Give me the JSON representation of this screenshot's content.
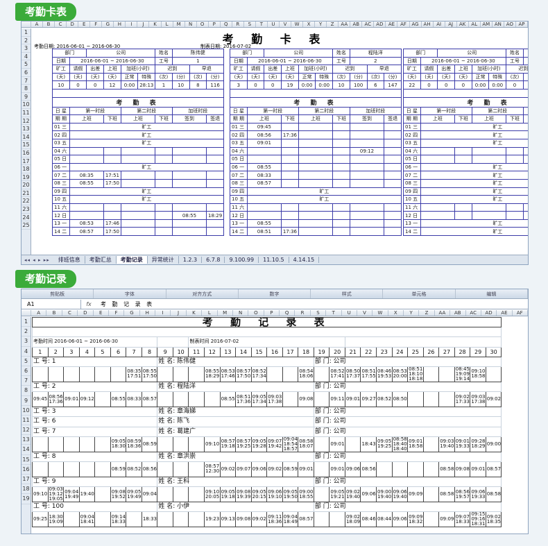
{
  "badges": {
    "card": "考勤卡表",
    "record": "考勤记录"
  },
  "sheet1": {
    "cols": [
      "A",
      "B",
      "C",
      "D",
      "E",
      "F",
      "G",
      "H",
      "I",
      "J",
      "K",
      "L",
      "M",
      "N",
      "O",
      "P",
      "Q",
      "R",
      "S",
      "T",
      "U",
      "V",
      "W",
      "X",
      "Y",
      "Z",
      "AA",
      "AB",
      "AC",
      "AD",
      "AE",
      "AF",
      "AG",
      "AH",
      "AI",
      "AJ",
      "AK",
      "AL",
      "AM",
      "AN",
      "AO",
      "AP"
    ],
    "rows": [
      "1",
      "2",
      "3",
      "4",
      "5",
      "6",
      "7",
      "8",
      "9",
      "10",
      "11",
      "12",
      "13",
      "14",
      "15",
      "16",
      "17",
      "18",
      "19",
      "20",
      "21",
      "22",
      "23",
      "24",
      "25"
    ],
    "title": "考 勤 卡 表",
    "period_label": "考勤日期: 2016-06-01 ~ 2016-06-30",
    "made_label": "制表日期: 2016-07-02",
    "blocks": [
      {
        "dept": "部门",
        "company": "公司",
        "name_label": "姓名",
        "name": "陈伟健",
        "date": "日期",
        "range": "2016-06-01 ~ 2016-06-30",
        "id_label": "工号",
        "id": "1",
        "summary": [
          "10",
          "0",
          "0",
          "12",
          "0:00",
          "28:13",
          "1",
          "10",
          "8",
          "116"
        ],
        "days": [
          [
            "01",
            "三",
            "旷工"
          ],
          [
            "02",
            "四",
            "旷工"
          ],
          [
            "03",
            "五",
            "旷工"
          ],
          [
            "04",
            "六",
            ""
          ],
          [
            "05",
            "日",
            ""
          ],
          [
            "06",
            "一",
            "旷工"
          ],
          [
            "07",
            "二",
            "08:35",
            "17:51"
          ],
          [
            "08",
            "三",
            "08:55",
            "17:50"
          ],
          [
            "09",
            "四",
            "旷工"
          ],
          [
            "10",
            "五",
            "旷工"
          ],
          [
            "11",
            "六",
            ""
          ],
          [
            "12",
            "日",
            "",
            "",
            "",
            "",
            "08:55",
            "18:29"
          ],
          [
            "13",
            "一",
            "08:53",
            "17:46"
          ],
          [
            "14",
            "二",
            "08:57",
            "17:50"
          ]
        ]
      },
      {
        "dept": "部门",
        "company": "公司",
        "name_label": "姓名",
        "name": "程陆洋",
        "date": "日期",
        "range": "2016-06-01 ~ 2016-06-30",
        "id_label": "工号",
        "id": "2",
        "summary": [
          "3",
          "0",
          "0",
          "19",
          "0:00",
          "0:00",
          "10",
          "100",
          "6",
          "147"
        ],
        "days": [
          [
            "01",
            "三",
            "09:45"
          ],
          [
            "02",
            "四",
            "08:56",
            "17:36"
          ],
          [
            "03",
            "五",
            "09:01"
          ],
          [
            "04",
            "六",
            "",
            "",
            "",
            "",
            "09:12"
          ],
          [
            "05",
            "日",
            ""
          ],
          [
            "06",
            "一",
            "08:55"
          ],
          [
            "07",
            "二",
            "08:33"
          ],
          [
            "08",
            "三",
            "08:57"
          ],
          [
            "09",
            "四",
            "旷工"
          ],
          [
            "10",
            "五",
            "旷工"
          ],
          [
            "11",
            "六",
            ""
          ],
          [
            "12",
            "日",
            ""
          ],
          [
            "13",
            "一",
            "08:55"
          ],
          [
            "14",
            "二",
            "08:51",
            "17:36"
          ]
        ]
      },
      {
        "dept": "部门",
        "company": "公司",
        "name_label": "姓名",
        "name": "章海",
        "date": "日期",
        "range": "2016-06-01 ~ 2016-06-30",
        "id_label": "工号",
        "id": "3",
        "summary": [
          "22",
          "0",
          "0",
          "0",
          "0:00",
          "0:00",
          "0",
          "0",
          "0",
          "0"
        ],
        "days": [
          [
            "01",
            "三",
            "旷工"
          ],
          [
            "02",
            "四",
            "旷工"
          ],
          [
            "03",
            "五",
            "旷工"
          ],
          [
            "04",
            "六",
            ""
          ],
          [
            "05",
            "日",
            ""
          ],
          [
            "06",
            "一",
            "旷工"
          ],
          [
            "07",
            "二",
            "旷工"
          ],
          [
            "08",
            "三",
            "旷工"
          ],
          [
            "09",
            "四",
            "旷工"
          ],
          [
            "10",
            "五",
            "旷工"
          ],
          [
            "11",
            "六",
            ""
          ],
          [
            "12",
            "日",
            ""
          ],
          [
            "13",
            "一",
            "旷工"
          ],
          [
            "14",
            "二",
            "旷工"
          ]
        ]
      }
    ],
    "hdr_labels": {
      "kuanggong": "旷工",
      "qingjia": "请假",
      "chuchai": "出差",
      "shangban": "上班",
      "jiaban": "加班(小时)",
      "chidao": "迟到",
      "zaotui": "早退",
      "tian": "(天)",
      "zhengchang": "正常",
      "teshu": "特殊",
      "ci": "(次)",
      "fen": "(分)"
    },
    "table_title": "考 勤 表",
    "day_hdr": "日 星",
    "day_hdr2": "期 期",
    "seg1": "第一时段",
    "seg2": "第二时段",
    "seg3": "加班时段",
    "on": "上班",
    "off": "下班",
    "signin": "签到",
    "signout": "签退",
    "tabs": [
      "排班信息",
      "考勤汇总",
      "考勤记录",
      "异常统计",
      "1.2.3",
      "6.7.8",
      "9.100.99",
      "11.10.5",
      "4.14.15"
    ]
  },
  "sheet2": {
    "ribbon": [
      "剪贴板",
      "字体",
      "对齐方式",
      "数字",
      "样式",
      "单元格",
      "编辑"
    ],
    "namebox": "A1",
    "formula": "考 勤 记 录 表",
    "cols": [
      "A",
      "B",
      "C",
      "D",
      "E",
      "F",
      "G",
      "H",
      "I",
      "J",
      "K",
      "L",
      "M",
      "N",
      "O",
      "P",
      "Q",
      "R",
      "S",
      "T",
      "U",
      "V",
      "W",
      "X",
      "Y",
      "Z",
      "AA",
      "AB",
      "AC",
      "AD",
      "AE",
      "AF"
    ],
    "rows": [
      "1",
      "2",
      "3",
      "4",
      "5",
      "6",
      "7",
      "8",
      "9",
      "10",
      "11",
      "12",
      "13",
      "14",
      "15",
      "16",
      "17",
      "18",
      "19"
    ],
    "title": "考 勤 记 录 表",
    "period": "考勤时间 2016-06-01 ~ 2016-06-30",
    "made": "制表时间 2016-07-02",
    "daynums": [
      "1",
      "2",
      "3",
      "4",
      "5",
      "6",
      "7",
      "8",
      "9",
      "10",
      "11",
      "12",
      "13",
      "14",
      "15",
      "16",
      "17",
      "18",
      "19",
      "20",
      "21",
      "22",
      "23",
      "24",
      "25",
      "26",
      "27",
      "28",
      "29",
      "30"
    ],
    "id_label": "工 号:",
    "name_label": "姓 名:",
    "dept_label": "部 门:",
    "company": "公司",
    "employees": [
      {
        "id": "1",
        "name": "陈伟健",
        "cells": [
          "",
          "",
          "",
          "",
          "",
          "",
          "08:35 17:51",
          "08:55 17:50",
          "",
          "",
          "",
          "08:55 18:29",
          "08:53 17:46",
          "08:57 17:50",
          "08:52 17:34",
          "",
          "",
          "08:54 18:06",
          "",
          "08:52 17:41",
          "08:50 17:37",
          "08:51 17:55",
          "08:46 19:53",
          "08:53 20:00",
          "08:51 18:10 18:18",
          "",
          "",
          "08:45 19:09 19:14",
          "09:10 18:58",
          ""
        ]
      },
      {
        "id": "2",
        "name": "程陆洋",
        "cells": [
          "09:45",
          "08:56 17:36",
          "09:01",
          "09:12",
          "",
          "08:55",
          "08:33",
          "08:57",
          "",
          "",
          "",
          "",
          "08:55",
          "08:51 17:36",
          "09:05 17:34",
          "09:03 17:38",
          "",
          "09:08",
          "",
          "09:11",
          "09:01",
          "09:27",
          "08:52",
          "08:50",
          "",
          "",
          "",
          "09:02 17:33",
          "09:03 17:38",
          "09:02"
        ]
      },
      {
        "id": "3",
        "name": "章海娣",
        "cells": []
      },
      {
        "id": "6",
        "name": "陈飞",
        "cells": []
      },
      {
        "id": "7",
        "name": "葛建广",
        "cells": [
          "",
          "",
          "",
          "",
          "",
          "09:05 18:30",
          "08:59 18:36",
          "08:59",
          "",
          "",
          "",
          "09:10",
          "08:57 19:18",
          "08:57 19:25",
          "09:05 19:28",
          "09:07 19:42",
          "09:04 18:54 18:57",
          "08:58 18:07",
          "",
          "09:01",
          "",
          "18:43",
          "09:05 19:25",
          "08:58 18:40 18:40",
          "09:01 18:58",
          "",
          "09:03 19:40",
          "09:01 19:33",
          "09:28 18:29",
          "09:00"
        ]
      },
      {
        "id": "8",
        "name": "章洪崇",
        "cells": [
          "",
          "",
          "",
          "",
          "",
          "08:59",
          "08:52",
          "08:56",
          "",
          "",
          "",
          "08:57 12:30",
          "09:02",
          "09:07",
          "09:06",
          "09:02",
          "08:59",
          "09:01",
          "",
          "09:01",
          "09:06",
          "08:56",
          "",
          "",
          "",
          "",
          "08:58",
          "09:08",
          "09:01",
          "08:57"
        ]
      },
      {
        "id": "9",
        "name": "王科",
        "cells": [
          "09:10",
          "09:03 19:12 19:05",
          "09:04 19:49",
          "19:40",
          "",
          "09:08 19:52",
          "09:05 19:49",
          "09:04",
          "",
          "",
          "",
          "09:10 20:05",
          "09:05 19:18",
          "09:08 19:39",
          "09:05 20:15",
          "09:06 19:10",
          "09:05 19:50",
          "09:00 18:55",
          "",
          "09:05 19:21",
          "09:02 19:40",
          "09:06",
          "09:00 19:40",
          "09:06 19:40",
          "09:09",
          "",
          "08:58",
          "08:56 19:57",
          "09:06 19:33",
          "08:58"
        ]
      },
      {
        "id": "100",
        "name": "小伊",
        "cells": [
          "09:25",
          "18:30 19:09",
          "",
          "09:04 18:41",
          "",
          "09:14 18:33",
          "",
          "18:33",
          "",
          "",
          "",
          "19:23",
          "09:13",
          "09:08",
          "09:02",
          "09:11 18:36",
          "09:04 18:49",
          "08:57",
          "",
          "",
          "09:02 18:09",
          "08:46",
          "08:44",
          "09:06",
          "09:09 18:32",
          "",
          "09:09",
          "09:07 18:33",
          "09:15 09:16 18:31",
          "09:02 18:35"
        ]
      }
    ]
  }
}
